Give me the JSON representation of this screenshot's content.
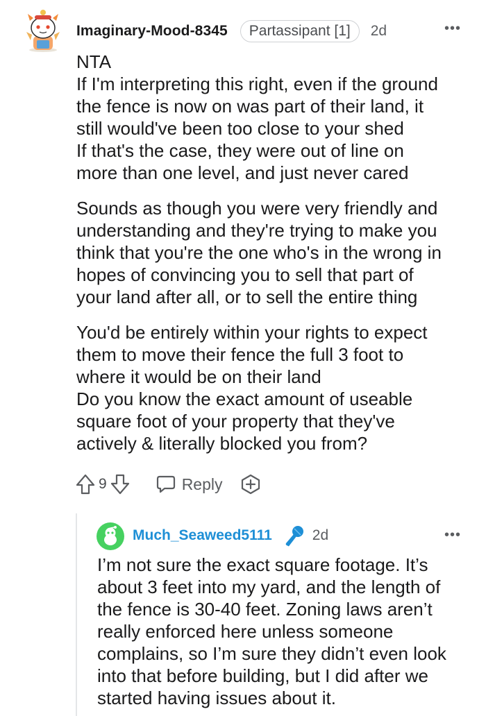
{
  "comment": {
    "username": "Imaginary-Mood-8345",
    "flair": "Partassipant [1]",
    "age": "2d",
    "more": "•••",
    "paragraphs": [
      [
        "NTA",
        "If I'm interpreting this right, even if the ground",
        "the fence is now on was part of their land, it",
        "still would've been too close to your shed",
        "If that's the case, they were out of line on",
        "more than one level, and just never cared"
      ],
      [
        "Sounds as though you were very friendly and",
        "understanding and they're trying to make you",
        "think that you're the one who's in the wrong in",
        "hopes of convincing you to sell that part of",
        "your land after all, or to sell the entire thing"
      ],
      [
        "You'd be entirely within your rights to expect",
        "them to move their fence the full 3 foot to",
        "where it would be on their land",
        "Do you know the exact amount of useable",
        "square foot of your property that they've",
        "actively & literally blocked you from?"
      ]
    ],
    "score": "9",
    "reply_label": "Reply"
  },
  "reply": {
    "username": "Much_Seaweed5111",
    "age": "2d",
    "more": "•••",
    "lines": [
      "I’m not sure the exact square footage. It’s",
      "about 3 feet into my yard, and the length of",
      "the fence is 30-40 feet. Zoning laws aren’t",
      "really enforced here unless someone",
      "complains, so I’m sure they didn’t even look",
      "into that before building, but I did after we",
      "started having issues about it."
    ]
  },
  "colors": {
    "text": "#1a1a1b",
    "meta": "#5b5d60",
    "reply_username": "#1e8fd6",
    "reply_avatar": "#46d160",
    "mic_icon": "#1e8fd6",
    "thread_line": "#e4e6e8"
  },
  "icons": {
    "upvote": "upvote-arrow-icon",
    "downvote": "downvote-arrow-icon",
    "reply": "speech-bubble-icon",
    "award": "plus-circle-award-icon",
    "mic": "microphone-icon",
    "more": "more-options-icon"
  }
}
